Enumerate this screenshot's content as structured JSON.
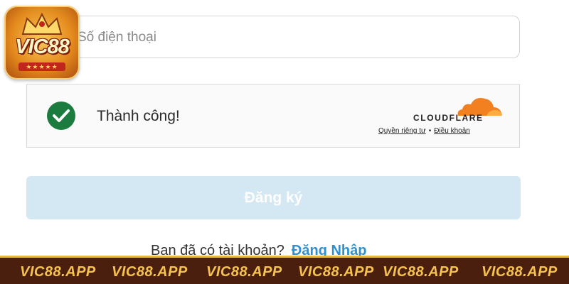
{
  "logo": {
    "text": "VIC88",
    "ribbon": "★★★★★"
  },
  "phone_field": {
    "placeholder": "Số điện thoại",
    "value": ""
  },
  "captcha": {
    "status": "Thành công!",
    "provider": "CLOUDFLARE",
    "privacy_link": "Quyền riêng tư",
    "separator": "•",
    "terms_link": "Điều khoản",
    "check_color": "#1c7c3f",
    "provider_color": "#f38020"
  },
  "register_button": {
    "label": "Đăng ký",
    "color": "#d4e8f4"
  },
  "login_prompt": {
    "text": "Bạn đã có tài khoản?",
    "link": "Đăng Nhập",
    "link_color": "#2f8fcf"
  },
  "bottom_banner": {
    "items": [
      "VIC88.APP",
      "VIC88.APP",
      "VIC88.APP",
      "VIC88.APP",
      "VIC88.APP",
      "VIC88.APP"
    ],
    "background": "#4a1f0e",
    "text_color": "#f6c350"
  }
}
